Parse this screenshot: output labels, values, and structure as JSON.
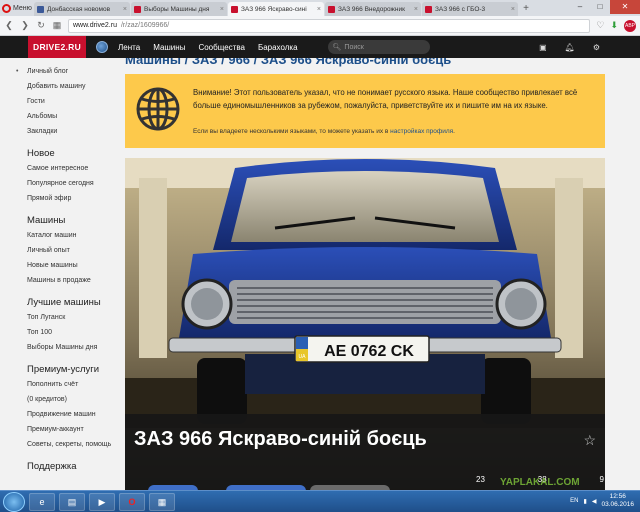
{
  "browser": {
    "menu_label": "Меню",
    "tabs": [
      {
        "title": "Донбасская новомов",
        "favicon": "facebook",
        "active": false
      },
      {
        "title": "Выборы Машины дня",
        "favicon": "drive2",
        "active": false
      },
      {
        "title": "ЗАЗ 966 Яскраво-сині",
        "favicon": "drive2",
        "active": true
      },
      {
        "title": "ЗАЗ 966 Внедорожник",
        "favicon": "drive2",
        "active": false
      },
      {
        "title": "ЗАЗ 966 с ГБО-3",
        "favicon": "drive2",
        "active": false
      }
    ],
    "new_tab": "+",
    "address": {
      "host": "www.drive2.ru",
      "path": "/r/zaz/1609966/"
    },
    "abp_label": "ABP"
  },
  "site": {
    "logo": "DRIVE2.RU",
    "nav": [
      "Лента",
      "Машины",
      "Сообщества",
      "Барахолка"
    ],
    "search_placeholder": "Поиск"
  },
  "sidebar": {
    "groups": [
      {
        "heading": "",
        "items": [
          "Личный блог",
          "Добавить машину",
          "Гости",
          "Альбомы",
          "Закладки"
        ]
      },
      {
        "heading": "Новое",
        "items": [
          "Самое интересное",
          "Популярное сегодня",
          "Прямой эфир"
        ]
      },
      {
        "heading": "Машины",
        "items": [
          "Каталог машин",
          "Личный опыт",
          "Новые машины",
          "Машины в продаже"
        ]
      },
      {
        "heading": "Лучшие машины",
        "items": [
          "Топ Луганск",
          "Топ 100",
          "Выборы Машины дня"
        ]
      },
      {
        "heading": "Премиум-услуги",
        "items": [
          "Пополнить счёт",
          "(0 кредитов)",
          "Продвижение машин",
          "Премиум-аккаунт",
          "Советы, секреты, помощь"
        ]
      },
      {
        "heading": "Поддержка",
        "items": []
      }
    ]
  },
  "main": {
    "breadcrumb": "Машины / ЗАЗ / 966 / ЗАЗ 966 Яскраво-синій боєць",
    "warning": {
      "text": "Внимание! Этот пользователь указал, что не понимает русского языка. Наше сообщество привлекает всё больше единомышленников за рубежом, пожалуйста, приветствуйте их и пишите им на их языке.",
      "small_prefix": "Если вы владеете несколькими языками, то можете указать их в",
      "small_link": "настройках профиля",
      "small_suffix": "."
    },
    "car": {
      "title": "ЗАЗ 966 Яскраво-синій боєць",
      "plate_country": "UA",
      "plate": "AE 0762 CK",
      "body_color": "#1e3f99"
    },
    "stats": [
      "23",
      "38",
      "9"
    ]
  },
  "watermark": "YAPLAKAL.COM",
  "taskbar": {
    "lang": "EN",
    "time": "12:56",
    "date": "03.06.2016"
  }
}
